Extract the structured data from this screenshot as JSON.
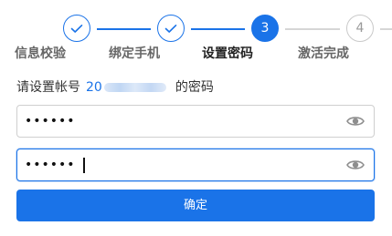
{
  "stepper": {
    "steps": [
      {
        "label": "信息校验",
        "state": "done"
      },
      {
        "label": "绑定手机",
        "state": "done"
      },
      {
        "label": "设置密码",
        "state": "active",
        "number": "3"
      },
      {
        "label": "激活完成",
        "state": "todo",
        "number": "4"
      }
    ]
  },
  "prompt": {
    "prefix": "请设置帐号",
    "account_visible": "20",
    "suffix": "的密码"
  },
  "password": {
    "value": "••••••"
  },
  "confirm_password": {
    "value": "••••••"
  },
  "submit": {
    "label": "确定"
  },
  "colors": {
    "accent": "#1a73e8",
    "inactive": "#c9c9c9"
  },
  "icons": {
    "step_done": "check-icon",
    "password_toggle": "eye-icon"
  }
}
